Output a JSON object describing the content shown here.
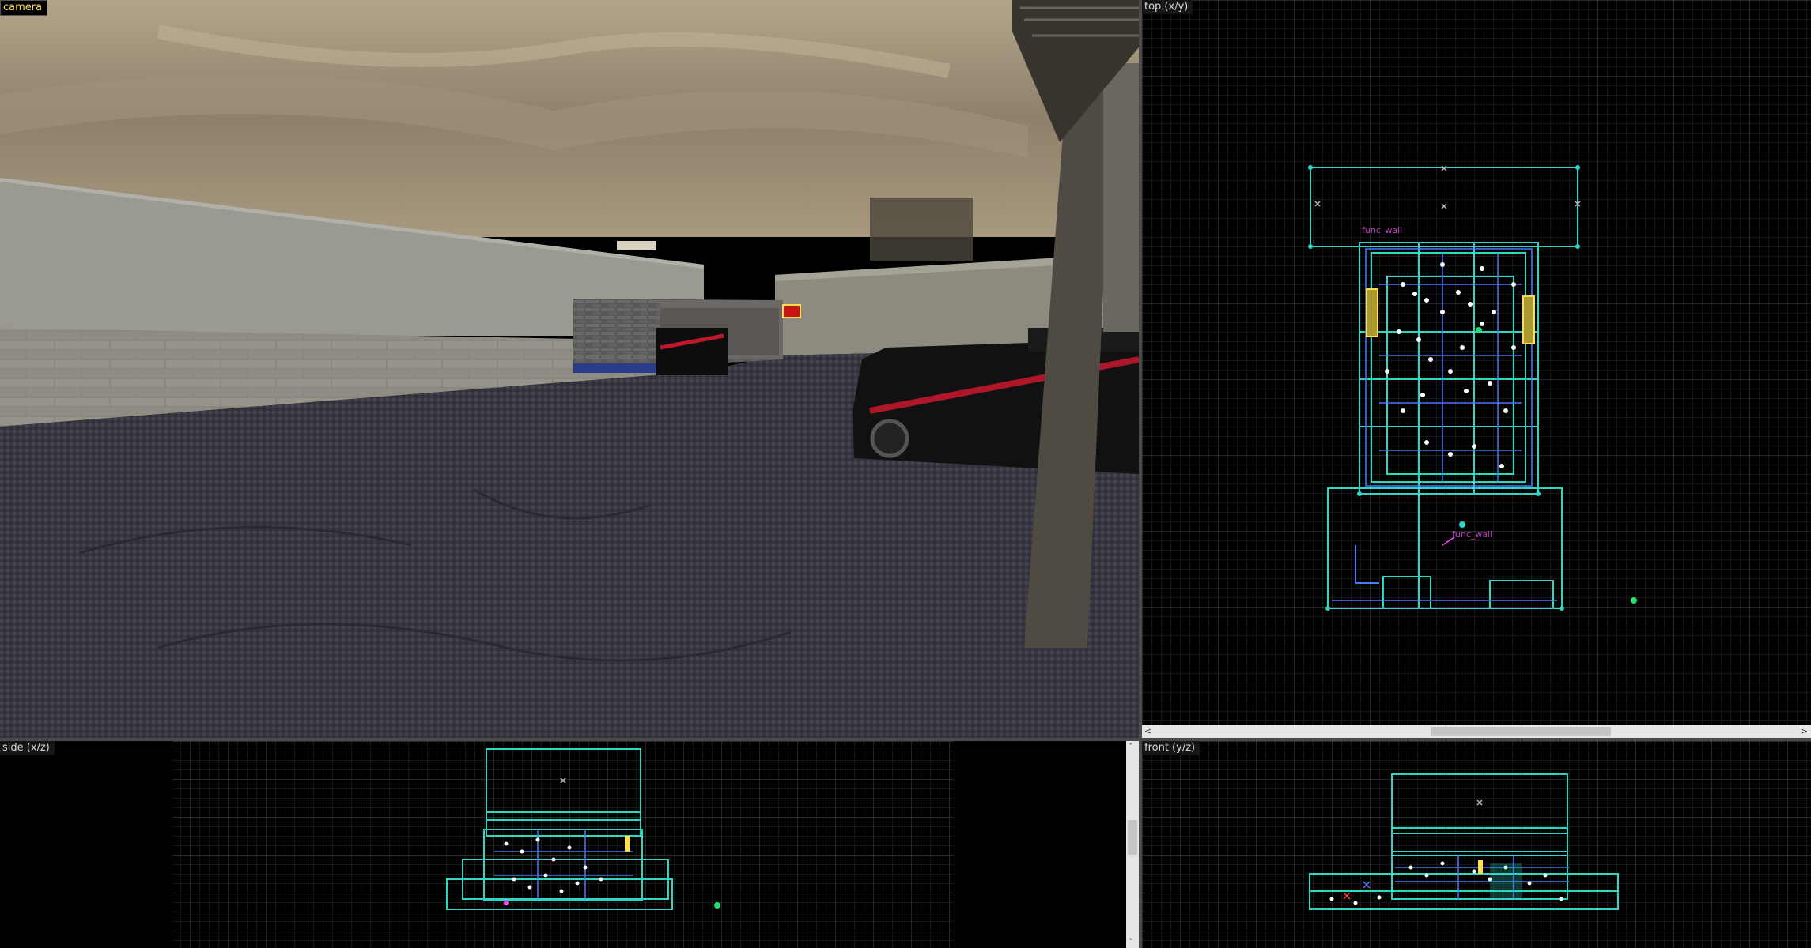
{
  "viewports": {
    "camera": {
      "label": "camera"
    },
    "top": {
      "label": "top (x/y)"
    },
    "side": {
      "label": "side (x/z)"
    },
    "front": {
      "label": "front (y/z)"
    }
  },
  "entities": {
    "top_label_1": "func_wall",
    "top_label_2": "func_wall"
  },
  "colors": {
    "grid_minor": "#2f2f2f",
    "grid_major": "#5a5a5a",
    "brush": "#2fd6c4",
    "brush_blue": "#4a78ff",
    "entity": "#ff44ff",
    "selected_yellow": "#ffde4a",
    "point_entity": "#20e070"
  },
  "icons": {
    "scroll_up": "scroll-up-arrow",
    "scroll_down": "scroll-down-arrow",
    "scroll_left": "scroll-left-arrow",
    "scroll_right": "scroll-right-arrow"
  }
}
